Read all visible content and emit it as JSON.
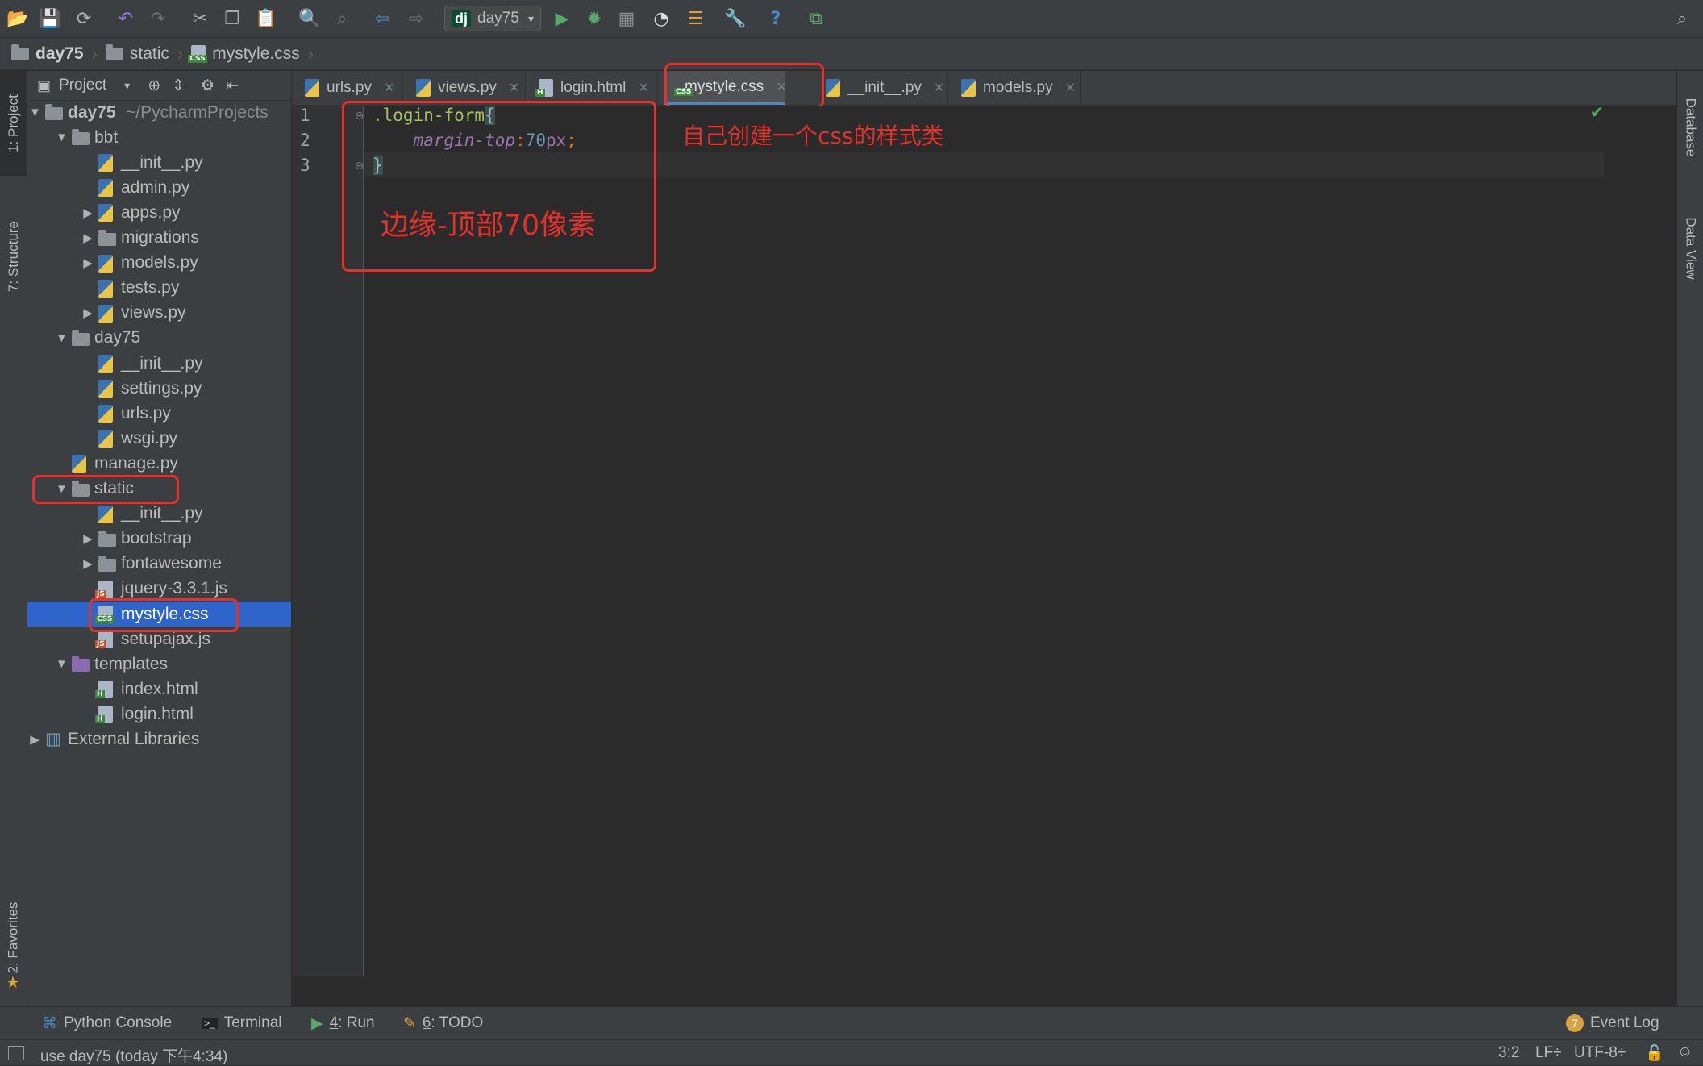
{
  "toolbar": {
    "run_config": "day75",
    "icons": [
      "open-folder-icon",
      "save-icon",
      "sync-icon",
      "undo-icon",
      "redo-icon",
      "cut-icon",
      "copy-icon",
      "paste-icon",
      "find-icon",
      "find-usages-icon",
      "back-icon",
      "forward-icon",
      "run-icon",
      "debug-icon",
      "coverage-icon",
      "profile-icon",
      "tasks-icon",
      "settings-icon",
      "help-icon",
      "vcs-icon",
      "search-icon"
    ]
  },
  "breadcrumb": [
    "day75",
    "static",
    "mystyle.css"
  ],
  "left_strip": {
    "project": "1: Project",
    "structure": "7: Structure",
    "favorites": "2: Favorites"
  },
  "right_strip": {
    "database": "Database",
    "data_view": "Data View"
  },
  "project_panel": {
    "title": "Project"
  },
  "tree": [
    {
      "label": "day75",
      "hint": "~/PycharmProjects",
      "kind": "folder-open"
    },
    {
      "label": "bbt",
      "kind": "folder-open"
    },
    {
      "label": "__init__.py",
      "kind": "py"
    },
    {
      "label": "admin.py",
      "kind": "py"
    },
    {
      "label": "apps.py",
      "kind": "py-collapsed"
    },
    {
      "label": "migrations",
      "kind": "folder-collapsed"
    },
    {
      "label": "models.py",
      "kind": "py-collapsed"
    },
    {
      "label": "tests.py",
      "kind": "py"
    },
    {
      "label": "views.py",
      "kind": "py-collapsed"
    },
    {
      "label": "day75",
      "kind": "folder-open"
    },
    {
      "label": "__init__.py",
      "kind": "py"
    },
    {
      "label": "settings.py",
      "kind": "py"
    },
    {
      "label": "urls.py",
      "kind": "py"
    },
    {
      "label": "wsgi.py",
      "kind": "py"
    },
    {
      "label": "manage.py",
      "kind": "py"
    },
    {
      "label": "static",
      "kind": "folder-open"
    },
    {
      "label": "__init__.py",
      "kind": "py"
    },
    {
      "label": "bootstrap",
      "kind": "folder-collapsed"
    },
    {
      "label": "fontawesome",
      "kind": "folder-collapsed"
    },
    {
      "label": "jquery-3.3.1.js",
      "kind": "js"
    },
    {
      "label": "mystyle.css",
      "kind": "css"
    },
    {
      "label": "setupajax.js",
      "kind": "js"
    },
    {
      "label": "templates",
      "kind": "folder-open"
    },
    {
      "label": "index.html",
      "kind": "html"
    },
    {
      "label": "login.html",
      "kind": "html"
    },
    {
      "label": "External Libraries",
      "kind": "lib"
    }
  ],
  "tabs": [
    {
      "label": "urls.py"
    },
    {
      "label": "views.py"
    },
    {
      "label": "login.html"
    },
    {
      "label": "mystyle.css"
    },
    {
      "label": "__init__.py"
    },
    {
      "label": "models.py"
    }
  ],
  "code": {
    "line_numbers": [
      "1",
      "2",
      "3"
    ],
    "selector": ".login-form",
    "open_brace": "{",
    "property": "margin-top",
    "colon": ":",
    "number": "70",
    "unit": "px",
    "semicolon": ";",
    "close_brace": "}"
  },
  "annotations": {
    "top_note": "自己创建一个css的样式类",
    "box_note": "边缘-顶部70像素"
  },
  "bottom_tools": {
    "python_console": "Python Console",
    "terminal": "Terminal",
    "run_num": "4",
    "run": ": Run",
    "todo_num": "6",
    "todo": ": TODO",
    "event_log_count": "7",
    "event_log": "Event Log"
  },
  "status": {
    "message": "use day75 (today 下午4:34)",
    "position": "3:2",
    "line_sep": "LF÷",
    "encoding": "UTF-8÷"
  },
  "colors": {
    "accent": "#4a88c7",
    "selection": "#2f65ca",
    "annotation": "#e8302a",
    "css_selector": "#a5c25c",
    "css_property": "#9876aa",
    "css_number": "#6897bb"
  }
}
